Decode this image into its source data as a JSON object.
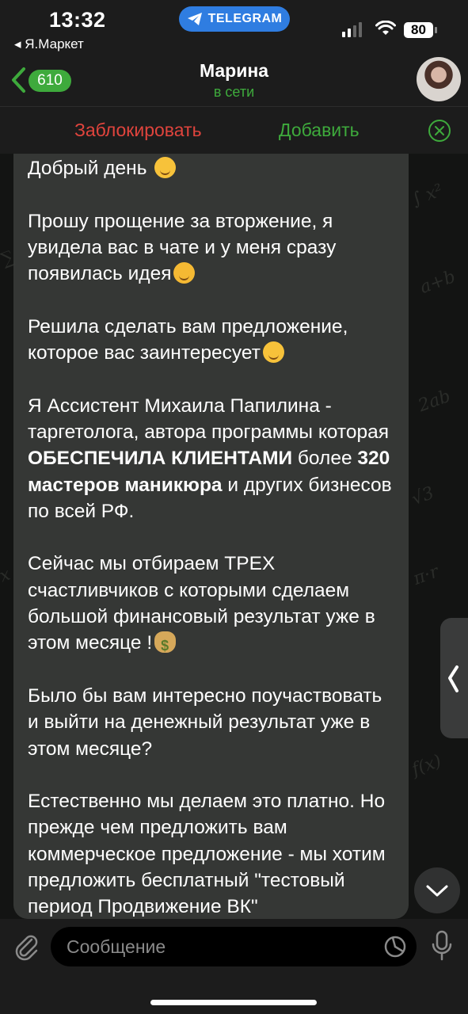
{
  "status_bar": {
    "time": "13:32",
    "back_app": "◂ Я.Маркет",
    "pill_label": "TELEGRAM",
    "battery": "80"
  },
  "header": {
    "unread_count": "610",
    "contact_name": "Марина",
    "contact_status": "в сети"
  },
  "action_bar": {
    "block_label": "Заблокировать",
    "add_label": "Добавить"
  },
  "message": {
    "p1": "Добрый день",
    "p2": "Прошу прощение за вторжение, я увидела вас в чате и у меня сразу появилась идея",
    "p3": "Решила сделать вам предложение, которое вас заинтересует",
    "p4_a": "Я Ассистент Михаила Папилина - таргетолога, автора программы которая ",
    "p4_b": "ОБЕСПЕЧИЛА КЛИЕНТАМИ",
    "p4_c": " более ",
    "p4_d": "320 мастеров маникюра",
    "p4_e": " и других бизнесов по всей РФ.",
    "p5": "Сейчас мы отбираем ТРЕХ счастливчиков с которыми сделаем большой финансовый результат уже в этом месяце !",
    "p6": "Было бы вам интересно поучаствовать и выйти на денежный результат уже в этом месяце?",
    "p7": "Естественно мы делаем это платно. Но прежде чем предложить вам коммерческое предложение - мы хотим предложить бесплатный \"тестовый период Продвижение ВК\""
  },
  "input": {
    "placeholder": "Сообщение"
  },
  "colors": {
    "accent_green": "#3eaa3c",
    "danger_red": "#e0443d",
    "telegram_blue": "#2f7de1"
  }
}
